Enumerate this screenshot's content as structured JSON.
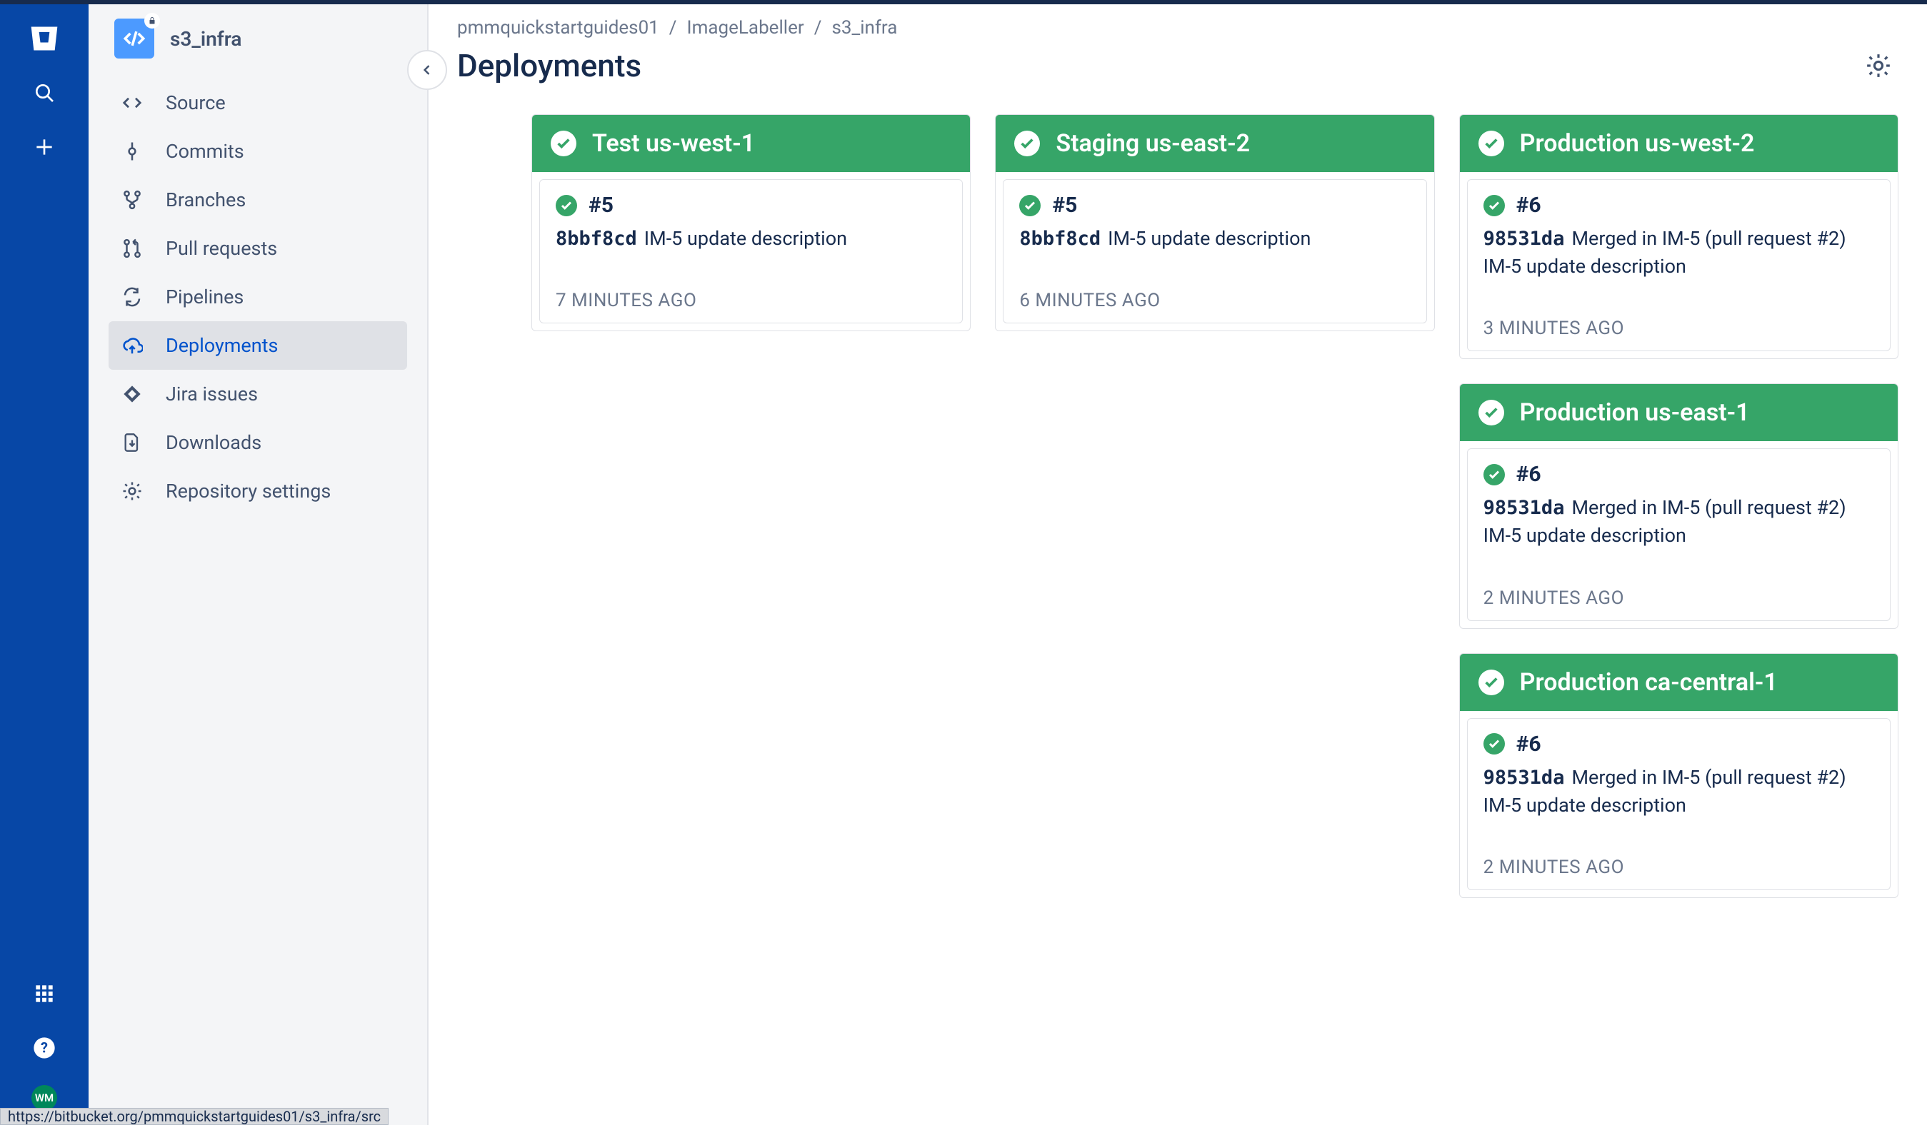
{
  "globalNav": {
    "avatarInitials": "WM"
  },
  "repo": {
    "name": "s3_infra"
  },
  "sidebar": {
    "items": [
      {
        "icon": "code",
        "label": "Source"
      },
      {
        "icon": "commits",
        "label": "Commits"
      },
      {
        "icon": "branches",
        "label": "Branches"
      },
      {
        "icon": "pull-requests",
        "label": "Pull requests"
      },
      {
        "icon": "pipelines",
        "label": "Pipelines"
      },
      {
        "icon": "deployments",
        "label": "Deployments"
      },
      {
        "icon": "jira",
        "label": "Jira issues"
      },
      {
        "icon": "downloads",
        "label": "Downloads"
      },
      {
        "icon": "settings",
        "label": "Repository settings"
      }
    ]
  },
  "breadcrumbs": [
    "pmmquickstartguides01",
    "ImageLabeller",
    "s3_infra"
  ],
  "page": {
    "title": "Deployments"
  },
  "columns": [
    [
      {
        "name": "Test us-west-1",
        "build": "#5",
        "hash": "8bbf8cd",
        "msg": "IM-5 update description",
        "time": "7 MINUTES AGO"
      }
    ],
    [
      {
        "name": "Staging us-east-2",
        "build": "#5",
        "hash": "8bbf8cd",
        "msg": "IM-5 update description",
        "time": "6 MINUTES AGO"
      }
    ],
    [
      {
        "name": "Production us-west-2",
        "build": "#6",
        "hash": "98531da",
        "msg": "Merged in IM-5 (pull request #2) IM-5 update description",
        "time": "3 MINUTES AGO"
      },
      {
        "name": "Production us-east-1",
        "build": "#6",
        "hash": "98531da",
        "msg": "Merged in IM-5 (pull request #2) IM-5 update description",
        "time": "2 MINUTES AGO"
      },
      {
        "name": "Production ca-central-1",
        "build": "#6",
        "hash": "98531da",
        "msg": "Merged in IM-5 (pull request #2) IM-5 update description",
        "time": "2 MINUTES AGO"
      }
    ]
  ],
  "statusBar": "https://bitbucket.org/pmmquickstartguides01/s3_infra/src"
}
